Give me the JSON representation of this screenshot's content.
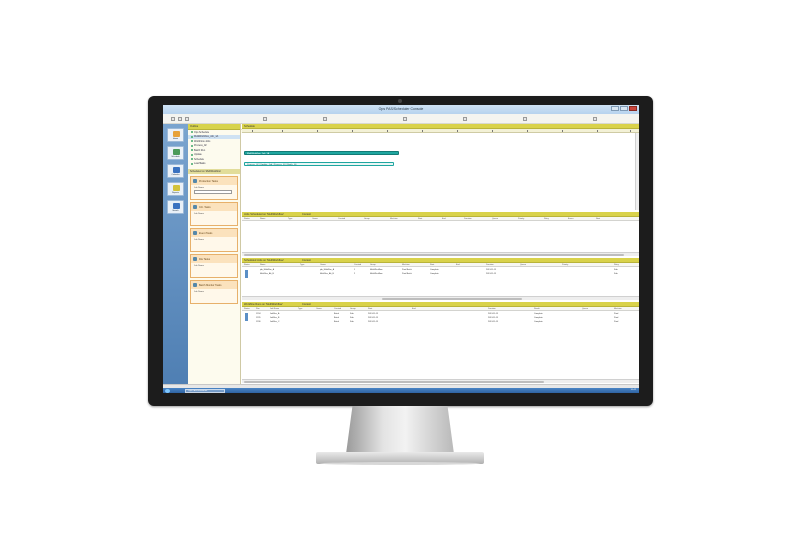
{
  "window": {
    "title": "Ops PAS/Scheduler Console"
  },
  "nav": [
    {
      "id": "home",
      "label": "Home",
      "color": "#e7a23a"
    },
    {
      "id": "schedule",
      "label": "Schedule",
      "color": "#4a9a5a"
    },
    {
      "id": "calendar",
      "label": "Calendar",
      "color": "#3a72c0"
    },
    {
      "id": "reports",
      "label": "Reports",
      "color": "#d2c23a"
    },
    {
      "id": "search",
      "label": "Search",
      "color": "#3a72c0"
    }
  ],
  "tree": {
    "header": "Outline",
    "items": [
      "Ops Schedule",
      "MultiWorkflow_Job_1A",
      "WorkFlow Jobs",
      "Process_02",
      "Batch Run",
      "Update",
      "Schedule",
      "LoadTasks"
    ]
  },
  "side_section": "Scheduled on 'MultiWorkflow'",
  "tasks": [
    {
      "title": "Production Tasks",
      "field_label": "Job Name",
      "field_value": "",
      "accent": "#e7b06a"
    },
    {
      "title": "Crit. Tasks",
      "field_label": "Job Name",
      "field_value": ""
    },
    {
      "title": "Event Tasks",
      "field_label": "Job Name",
      "field_value": ""
    },
    {
      "title": "File Tasks",
      "field_label": "Job Name",
      "field_value": ""
    },
    {
      "title": "Batch Monitor Tasks",
      "field_label": "Job Name",
      "field_value": ""
    }
  ],
  "gantt": {
    "header": "Schedule",
    "bars": [
      {
        "label": "MultiWorkflow_Job_1A"
      },
      {
        "label": "Process_02  |  Update_Job  |  Process_03  |  Batch_06"
      }
    ]
  },
  "section2": {
    "header": "Jobs Scheduled on 'MultiWorkflow'",
    "tag": "Context",
    "columns": [
      "Status",
      "Name",
      "Type",
      "Owner",
      "Created",
      "Group",
      "Machine",
      "Start",
      "End",
      "Duration",
      "Queue",
      "Priority",
      "Retry",
      "Errors",
      "Next"
    ]
  },
  "section3": {
    "header": "Scheduled Jobs on 'MultiWorkflow'",
    "tag": "Context",
    "columns": [
      "Status",
      "Name",
      "Type",
      "Owner",
      "Created",
      "Group",
      "Machine",
      "Start",
      "End",
      "Duration",
      "Queue",
      "Priority",
      "Retry"
    ],
    "rows": [
      [
        "",
        "job_MultiRun_A",
        "",
        "job_MultiRun_A",
        "1",
        "MultiWorkflow",
        "Prod Batch",
        "Complete",
        "",
        "2013-11-15",
        "",
        "",
        "Sub"
      ],
      [
        "",
        "MultiRun_Alt_B",
        "",
        "MultiRun_Alt_B",
        "2",
        "MultiWorkflow",
        "Prod Batch",
        "Complete",
        "",
        "2013-11-15",
        "",
        "",
        "Sub"
      ]
    ]
  },
  "section4": {
    "header": "Workflow Runs on 'MultiWorkflow'",
    "tag": "Context",
    "columns": [
      "Status",
      "Run",
      "Job Name",
      "Type",
      "Owner",
      "Created",
      "Group",
      "Start",
      "End",
      "Duration",
      "Result",
      "Queue",
      "Machine"
    ],
    "rows": [
      [
        "",
        "1234",
        "JobRun_A",
        "",
        "",
        "Batch",
        "Sub",
        "2013-11-15",
        "",
        "2013-11-15",
        "Complete",
        "",
        "Prod"
      ],
      [
        "",
        "1235",
        "JobRun_B",
        "",
        "",
        "Batch",
        "Sub",
        "2013-11-15",
        "",
        "2013-11-15",
        "Complete",
        "",
        "Prod"
      ],
      [
        "",
        "1236",
        "JobRun_C",
        "",
        "",
        "Batch",
        "Sub",
        "2013-11-15",
        "",
        "2013-11-15",
        "Complete",
        "",
        "Prod"
      ]
    ]
  },
  "taskbar": {
    "app": "Ops PAS/Scheduler",
    "tray": "10:42"
  }
}
